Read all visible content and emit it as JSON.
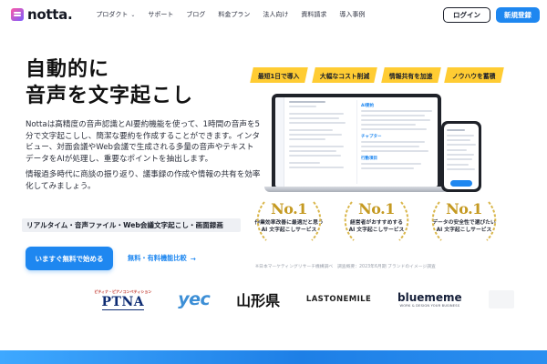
{
  "header": {
    "logo_text": "notta.",
    "nav": [
      {
        "label": "プロダクト",
        "has_dropdown": true
      },
      {
        "label": "サポート"
      },
      {
        "label": "ブログ"
      },
      {
        "label": "料金プラン"
      },
      {
        "label": "法人向け"
      },
      {
        "label": "資料請求"
      },
      {
        "label": "導入事例"
      }
    ],
    "login_label": "ログイン",
    "signup_label": "新規登録"
  },
  "hero": {
    "title_line1": "自動的に",
    "title_line2": "音声を文字起こし",
    "desc_p1": "Nottaは高精度の音声認識とAI要約機能を使って、1時間の音声を5分で文字起こしし、簡潔な要約を作成することができます。インタビュー、対面会議やWeb会議で生成される多量の音声やテキストデータをAIが処理し、重要なポイントを抽出します。",
    "desc_p2": "情報過多時代に商談の振り返り、議事録の作成や情報の共有を効率化してみましょう。",
    "feature_strip": "リアルタイム・音声ファイル・Web会議文字起こし・画面録画",
    "cta_primary": "いますぐ無料で始める",
    "cta_secondary": "無料・有料機能比較",
    "cta_arrow": "→"
  },
  "tags": [
    "最短1日で導入",
    "大幅なコスト削減",
    "情報共有を加速",
    "ノウハウを蓄積"
  ],
  "device_mock": {
    "panel_heading_1": "AI要約",
    "panel_heading_2": "チャプター",
    "panel_heading_3": "行動項目"
  },
  "badges": [
    {
      "rank": "No.1",
      "line1": "作業効率改善に最適だと思う",
      "line2": "AI 文字起こしサービス"
    },
    {
      "rank": "No.1",
      "line1": "経営者がおすすめする",
      "line2": "AI 文字起こしサービス"
    },
    {
      "rank": "No.1",
      "line1": "データの安全性で選びたい",
      "line2": "AI 文字起こしサービス"
    }
  ],
  "badge_note": "※日本マーケティングリサーチ機構調べ　調査概要：2023年6月期 ブランドのイメージ調査",
  "logos": {
    "ptna_sub": "ピティナ・ピアノコンペティション",
    "ptna_main": "PTNA",
    "yec": "yec",
    "yamagata": "山形県",
    "lastonemile": "LASTONEMILE",
    "bluememe_main": "bluememe",
    "bluememe_sub": "WORK & DESIGN YOUR BUSINESS"
  },
  "colors": {
    "accent": "#1e87f0",
    "tag_yellow": "#ffcc33",
    "gold": "#c59a22"
  }
}
